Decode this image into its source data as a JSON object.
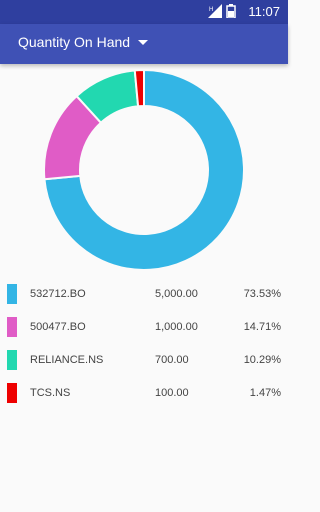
{
  "status_bar": {
    "time": "11:07",
    "icons": [
      "signal-icon",
      "battery-icon"
    ]
  },
  "toolbar": {
    "title": "Quantity On Hand"
  },
  "chart_data": {
    "type": "pie",
    "labels": [
      "532712.BO",
      "500477.BO",
      "RELIANCE.NS",
      "TCS.NS"
    ],
    "values": [
      5000,
      1000,
      700,
      100
    ],
    "percentages": [
      "73.53%",
      "14.71%",
      "10.29%",
      "1.47%"
    ],
    "colors": [
      "#33b5e5",
      "#e05cc6",
      "#22d8b0",
      "#ee0000"
    ]
  },
  "legend": [
    {
      "symbol": "532712.BO",
      "quantity": "5,000.00",
      "percent": "73.53%",
      "color": "#33b5e5"
    },
    {
      "symbol": "500477.BO",
      "quantity": "1,000.00",
      "percent": "14.71%",
      "color": "#e05cc6"
    },
    {
      "symbol": "RELIANCE.NS",
      "quantity": "700.00",
      "percent": "10.29%",
      "color": "#22d8b0"
    },
    {
      "symbol": "TCS.NS",
      "quantity": "100.00",
      "percent": "1.47%",
      "color": "#ee0000"
    }
  ]
}
